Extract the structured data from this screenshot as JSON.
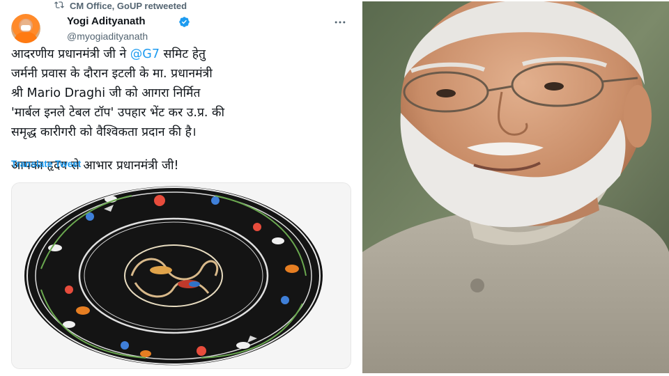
{
  "retweet": {
    "label": "CM Office, GoUP retweeted",
    "icon": "retweet-icon"
  },
  "author": {
    "name": "Yogi Adityanath",
    "handle": "@myogiadityanath",
    "verified": true,
    "verified_color": "#1d9bf0"
  },
  "tweet": {
    "line1_pre": "आदरणीय प्रधानमंत्री जी ने ",
    "mention": "@G7",
    "line1_post": " समिट हेतु",
    "line2": "जर्मनी प्रवास के दौरान इटली के मा. प्रधानमंत्री",
    "line3": "श्री Mario Draghi जी को आगरा निर्मित",
    "line4": "'मार्बल इनले टेबल टॉप' उपहार भेंट कर उ.प्र. की",
    "line5": "समृद्ध कारीगरी को वैश्विकता प्रदान की है।",
    "line6": "आपका हृदय से आभार प्रधानमंत्री जी!"
  },
  "translate_label": "Translate Tweet",
  "colors": {
    "link": "#1d9bf0",
    "text": "#0f1419",
    "secondary": "#536471"
  }
}
